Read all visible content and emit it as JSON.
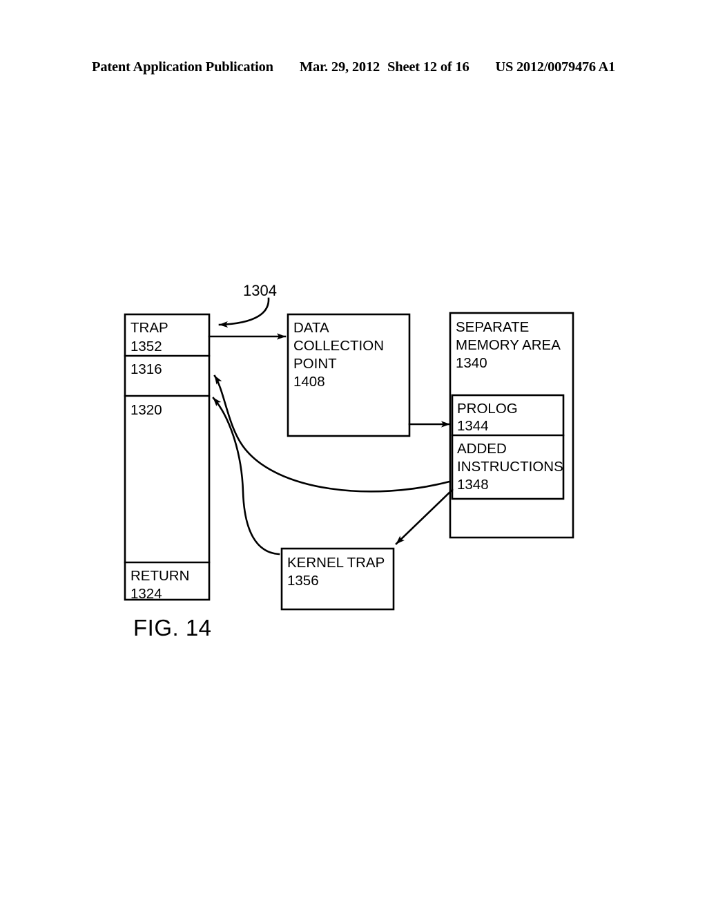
{
  "header": {
    "publication": "Patent Application Publication",
    "date": "Mar. 29, 2012",
    "sheet": "Sheet 12 of 16",
    "patent_number": "US 2012/0079476 A1"
  },
  "figure": {
    "label": "FIG. 14",
    "leader_reference": "1304"
  },
  "colors": {
    "ink": "#000000",
    "background": "#ffffff"
  },
  "diagram": {
    "call_stack": {
      "name": "call-stack-column",
      "segments": [
        {
          "title": "TRAP",
          "ref": "1352"
        },
        {
          "title": "",
          "ref": "1316"
        },
        {
          "title": "",
          "ref": "1320"
        },
        {
          "title": "RETURN",
          "ref": "1324"
        }
      ]
    },
    "boxes": [
      {
        "id": "data-collection-point",
        "lines": [
          "DATA",
          "COLLECTION",
          "POINT"
        ],
        "ref": "1408"
      },
      {
        "id": "separate-memory-area",
        "lines": [
          "SEPARATE",
          "MEMORY AREA"
        ],
        "ref": "1340"
      },
      {
        "id": "prolog",
        "lines": [
          "PROLOG"
        ],
        "ref": "1344"
      },
      {
        "id": "added-instructions",
        "lines": [
          "ADDED",
          "INSTRUCTIONS"
        ],
        "ref": "1348"
      },
      {
        "id": "kernel-trap",
        "lines": [
          "KERNEL TRAP"
        ],
        "ref": "1356"
      }
    ],
    "connectors": [
      {
        "id": "trap-to-data-collection-point",
        "from": "TRAP 1352",
        "to": "DATA COLLECTION POINT 1408"
      },
      {
        "id": "data-collection-point-to-prolog",
        "from": "DATA COLLECTION POINT 1408",
        "to": "PROLOG 1344"
      },
      {
        "id": "added-instructions-to-stack-1316",
        "from": "ADDED INSTRUCTIONS 1348",
        "to": "1316"
      },
      {
        "id": "kernel-trap-to-stack-1320",
        "from": "KERNEL TRAP 1356",
        "to": "1320"
      },
      {
        "id": "added-instructions-to-kernel-trap",
        "from": "ADDED INSTRUCTIONS 1348",
        "to": "KERNEL TRAP 1356"
      },
      {
        "id": "leader-1304-to-stack-top",
        "from": "1304",
        "to": "call-stack-column"
      }
    ]
  }
}
